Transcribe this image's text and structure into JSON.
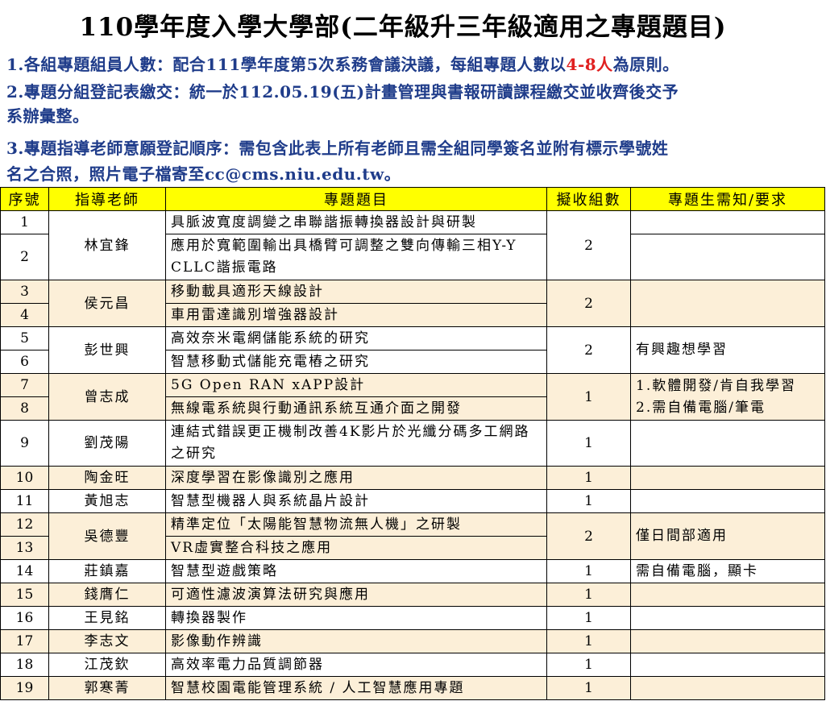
{
  "title": "110學年度入學大學部(二年級升三年級適用之專題題目)",
  "notes": {
    "n1_a": "1.各組專題組員人數：配合111學年度第5次系務會議決議，每組專題人數以",
    "n1_hl": "4-8人",
    "n1_b": "為原則。",
    "n2_l1": "2.專題分組登記表繳交：統一於112.05.19(五)計畫管理與書報研讀課程繳交並收齊後交予",
    "n2_l2": "系辦彙整。",
    "n3_l1": "3.專題指導老師意願登記順序：需包含此表上所有老師且需全組同學簽名並附有標示學號姓",
    "n3_l2": "名之合照，照片電子檔寄至cc@cms.niu.edu.tw。"
  },
  "table": {
    "headers": [
      "序號",
      "指導老師",
      "專題題目",
      "擬收組數",
      "專題生需知/要求"
    ],
    "teachers": [
      "林宜鋒",
      "侯元昌",
      "彭世興",
      "曾志成",
      "劉茂陽",
      "陶金旺",
      "黃旭志",
      "吳德豐",
      "莊鎮嘉",
      "錢膺仁",
      "王見銘",
      "李志文",
      "江茂欽",
      "郭寒菁"
    ],
    "counts": [
      "2",
      "2",
      "2",
      "1",
      "1",
      "1",
      "1",
      "2",
      "1",
      "1",
      "1",
      "1",
      "1",
      "1"
    ],
    "nums": [
      "1",
      "2",
      "3",
      "4",
      "5",
      "6",
      "7",
      "8",
      "9",
      "10",
      "11",
      "12",
      "13",
      "14",
      "15",
      "16",
      "17",
      "18",
      "19"
    ],
    "topics": [
      "具脈波寬度調變之串聯諧振轉換器設計與研製",
      "應用於寬範圍輸出具橋臂可調整之雙向傳輸三相Y-Y CLLC諧振電路",
      "移動載具適形天線設計",
      "車用雷達識別增強器設計",
      "高效奈米電網儲能系統的研究",
      "智慧移動式儲能充電樁之研究",
      "5G Open RAN xAPP設計",
      "無線電系統與行動通訊系統互通介面之開發",
      "連結式錯誤更正機制改善4K影片於光纖分碼多工網路之研究",
      "深度學習在影像識別之應用",
      "智慧型機器人與系統晶片設計",
      "精準定位「太陽能智慧物流無人機」之研製",
      "VR虛實整合科技之應用",
      "智慧型遊戲策略",
      "可適性濾波演算法研究與應用",
      "轉換器製作",
      "影像動作辨識",
      "高效率電力品質調節器",
      "智慧校園電能管理系統 / 人工智慧應用專題"
    ],
    "requirements": {
      "r_peng": "有興趣想學習",
      "r_tseng_1": "1.軟體開發/肯自我學習",
      "r_tseng_2": "2.需自備電腦/筆電",
      "r_wu": "僅日間部適用",
      "r_chuang": "需自備電腦，顯卡"
    }
  }
}
